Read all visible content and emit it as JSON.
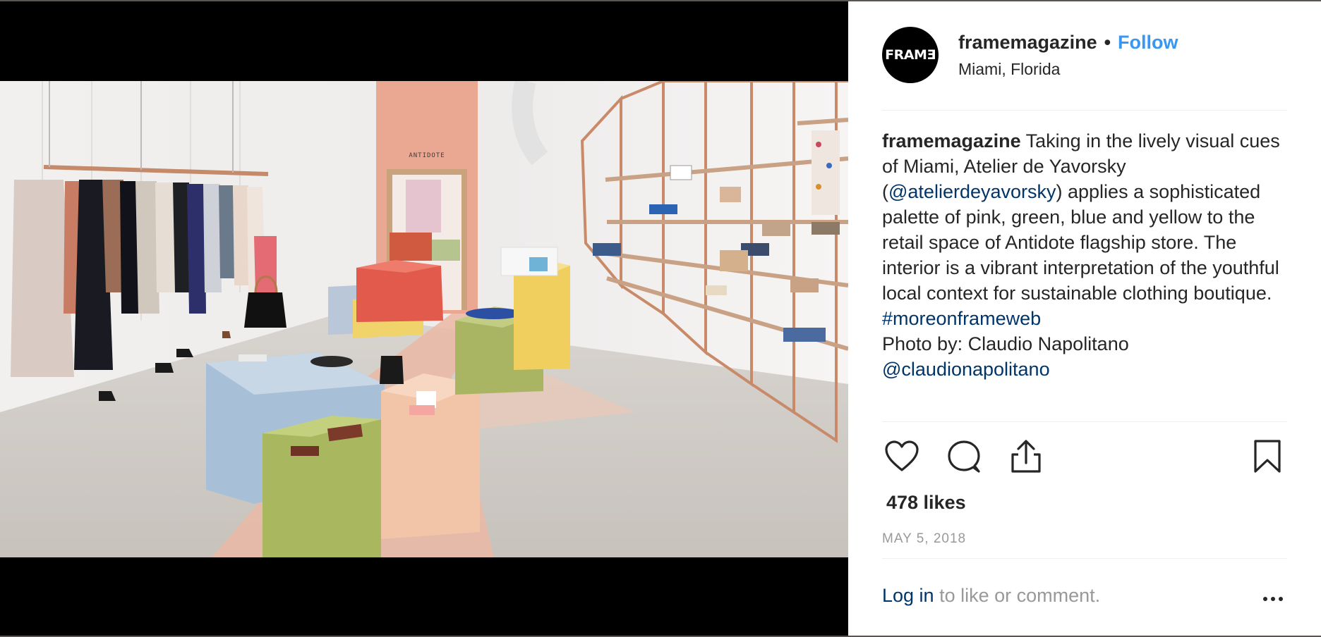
{
  "post": {
    "avatar_text": "FRAMƎ",
    "username": "framemagazine",
    "separator": "•",
    "follow_label": "Follow",
    "location": "Miami, Florida"
  },
  "caption": {
    "username": "framemagazine",
    "text_1": " Taking in the lively visual cues of Miami, Atelier de Yavorsky (",
    "mention_1": "@atelierdeyavorsky",
    "text_2": ") applies a sophisticated palette of pink, green, blue and yellow to the retail space of Antidote flagship store. The interior is a vibrant interpretation of the youthful local context for sustainable clothing boutique.",
    "hashtag": "#moreonframeweb",
    "photo_credit": "Photo by: Claudio Napolitano",
    "mention_2": "@claudionapolitano"
  },
  "photo": {
    "store_sign": "ANTIDOTE"
  },
  "actions": {
    "like_icon": "heart-icon",
    "comment_icon": "comment-bubble-icon",
    "share_icon": "share-upload-icon",
    "save_icon": "bookmark-icon"
  },
  "likes_text": "478 likes",
  "date_text": "MAY 5, 2018",
  "footer": {
    "login_link": "Log in",
    "login_suffix": " to like or comment.",
    "more_icon": "more-options-icon"
  },
  "colors": {
    "follow": "#3897f0",
    "link": "#003569",
    "muted": "#999999",
    "text": "#262626"
  }
}
